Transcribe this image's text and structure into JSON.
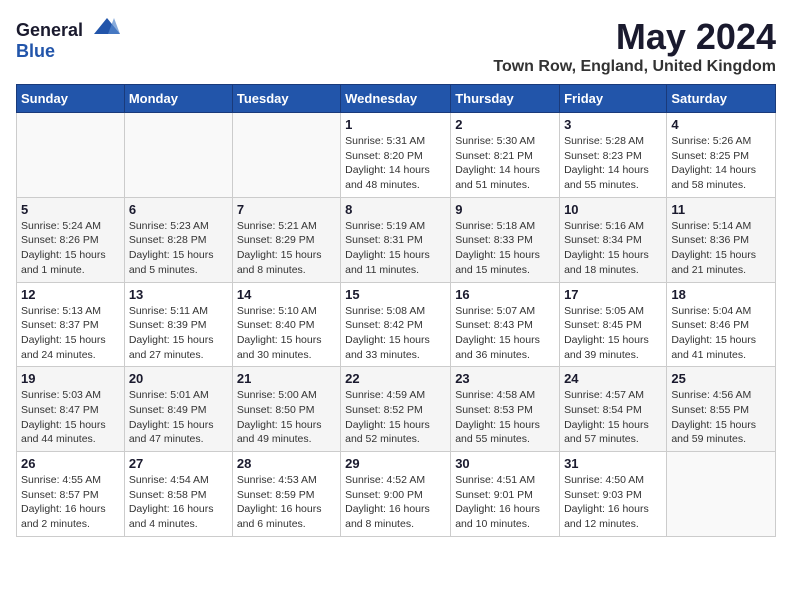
{
  "header": {
    "logo_general": "General",
    "logo_blue": "Blue",
    "title": "May 2024",
    "subtitle": "Town Row, England, United Kingdom"
  },
  "weekdays": [
    "Sunday",
    "Monday",
    "Tuesday",
    "Wednesday",
    "Thursday",
    "Friday",
    "Saturday"
  ],
  "weeks": [
    [
      {
        "day": "",
        "detail": ""
      },
      {
        "day": "",
        "detail": ""
      },
      {
        "day": "",
        "detail": ""
      },
      {
        "day": "1",
        "detail": "Sunrise: 5:31 AM\nSunset: 8:20 PM\nDaylight: 14 hours\nand 48 minutes."
      },
      {
        "day": "2",
        "detail": "Sunrise: 5:30 AM\nSunset: 8:21 PM\nDaylight: 14 hours\nand 51 minutes."
      },
      {
        "day": "3",
        "detail": "Sunrise: 5:28 AM\nSunset: 8:23 PM\nDaylight: 14 hours\nand 55 minutes."
      },
      {
        "day": "4",
        "detail": "Sunrise: 5:26 AM\nSunset: 8:25 PM\nDaylight: 14 hours\nand 58 minutes."
      }
    ],
    [
      {
        "day": "5",
        "detail": "Sunrise: 5:24 AM\nSunset: 8:26 PM\nDaylight: 15 hours\nand 1 minute."
      },
      {
        "day": "6",
        "detail": "Sunrise: 5:23 AM\nSunset: 8:28 PM\nDaylight: 15 hours\nand 5 minutes."
      },
      {
        "day": "7",
        "detail": "Sunrise: 5:21 AM\nSunset: 8:29 PM\nDaylight: 15 hours\nand 8 minutes."
      },
      {
        "day": "8",
        "detail": "Sunrise: 5:19 AM\nSunset: 8:31 PM\nDaylight: 15 hours\nand 11 minutes."
      },
      {
        "day": "9",
        "detail": "Sunrise: 5:18 AM\nSunset: 8:33 PM\nDaylight: 15 hours\nand 15 minutes."
      },
      {
        "day": "10",
        "detail": "Sunrise: 5:16 AM\nSunset: 8:34 PM\nDaylight: 15 hours\nand 18 minutes."
      },
      {
        "day": "11",
        "detail": "Sunrise: 5:14 AM\nSunset: 8:36 PM\nDaylight: 15 hours\nand 21 minutes."
      }
    ],
    [
      {
        "day": "12",
        "detail": "Sunrise: 5:13 AM\nSunset: 8:37 PM\nDaylight: 15 hours\nand 24 minutes."
      },
      {
        "day": "13",
        "detail": "Sunrise: 5:11 AM\nSunset: 8:39 PM\nDaylight: 15 hours\nand 27 minutes."
      },
      {
        "day": "14",
        "detail": "Sunrise: 5:10 AM\nSunset: 8:40 PM\nDaylight: 15 hours\nand 30 minutes."
      },
      {
        "day": "15",
        "detail": "Sunrise: 5:08 AM\nSunset: 8:42 PM\nDaylight: 15 hours\nand 33 minutes."
      },
      {
        "day": "16",
        "detail": "Sunrise: 5:07 AM\nSunset: 8:43 PM\nDaylight: 15 hours\nand 36 minutes."
      },
      {
        "day": "17",
        "detail": "Sunrise: 5:05 AM\nSunset: 8:45 PM\nDaylight: 15 hours\nand 39 minutes."
      },
      {
        "day": "18",
        "detail": "Sunrise: 5:04 AM\nSunset: 8:46 PM\nDaylight: 15 hours\nand 41 minutes."
      }
    ],
    [
      {
        "day": "19",
        "detail": "Sunrise: 5:03 AM\nSunset: 8:47 PM\nDaylight: 15 hours\nand 44 minutes."
      },
      {
        "day": "20",
        "detail": "Sunrise: 5:01 AM\nSunset: 8:49 PM\nDaylight: 15 hours\nand 47 minutes."
      },
      {
        "day": "21",
        "detail": "Sunrise: 5:00 AM\nSunset: 8:50 PM\nDaylight: 15 hours\nand 49 minutes."
      },
      {
        "day": "22",
        "detail": "Sunrise: 4:59 AM\nSunset: 8:52 PM\nDaylight: 15 hours\nand 52 minutes."
      },
      {
        "day": "23",
        "detail": "Sunrise: 4:58 AM\nSunset: 8:53 PM\nDaylight: 15 hours\nand 55 minutes."
      },
      {
        "day": "24",
        "detail": "Sunrise: 4:57 AM\nSunset: 8:54 PM\nDaylight: 15 hours\nand 57 minutes."
      },
      {
        "day": "25",
        "detail": "Sunrise: 4:56 AM\nSunset: 8:55 PM\nDaylight: 15 hours\nand 59 minutes."
      }
    ],
    [
      {
        "day": "26",
        "detail": "Sunrise: 4:55 AM\nSunset: 8:57 PM\nDaylight: 16 hours\nand 2 minutes."
      },
      {
        "day": "27",
        "detail": "Sunrise: 4:54 AM\nSunset: 8:58 PM\nDaylight: 16 hours\nand 4 minutes."
      },
      {
        "day": "28",
        "detail": "Sunrise: 4:53 AM\nSunset: 8:59 PM\nDaylight: 16 hours\nand 6 minutes."
      },
      {
        "day": "29",
        "detail": "Sunrise: 4:52 AM\nSunset: 9:00 PM\nDaylight: 16 hours\nand 8 minutes."
      },
      {
        "day": "30",
        "detail": "Sunrise: 4:51 AM\nSunset: 9:01 PM\nDaylight: 16 hours\nand 10 minutes."
      },
      {
        "day": "31",
        "detail": "Sunrise: 4:50 AM\nSunset: 9:03 PM\nDaylight: 16 hours\nand 12 minutes."
      },
      {
        "day": "",
        "detail": ""
      }
    ]
  ]
}
